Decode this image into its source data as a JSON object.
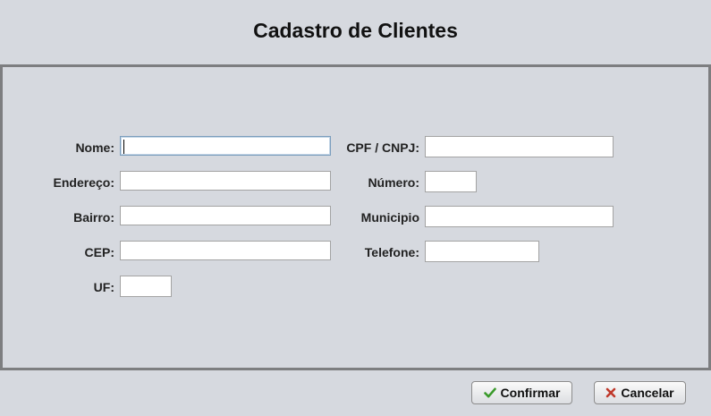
{
  "window": {
    "title": "Cadastro de Clientes"
  },
  "form": {
    "nome": {
      "label": "Nome:",
      "value": ""
    },
    "endereco": {
      "label": "Endereço:",
      "value": ""
    },
    "bairro": {
      "label": "Bairro:",
      "value": ""
    },
    "cep": {
      "label": "CEP:",
      "value": ""
    },
    "uf": {
      "label": "UF:",
      "value": ""
    },
    "cpf_cnpj": {
      "label": "CPF / CNPJ:",
      "value": ""
    },
    "numero": {
      "label": "Número:",
      "value": ""
    },
    "municipio": {
      "label": "Municipio",
      "value": ""
    },
    "telefone": {
      "label": "Telefone:",
      "value": ""
    }
  },
  "buttons": {
    "confirmar": {
      "label": "Confirmar",
      "icon": "check-icon",
      "icon_color": "#3a9a2a"
    },
    "cancelar": {
      "label": "Cancelar",
      "icon": "close-icon",
      "icon_color": "#c0392b"
    }
  }
}
